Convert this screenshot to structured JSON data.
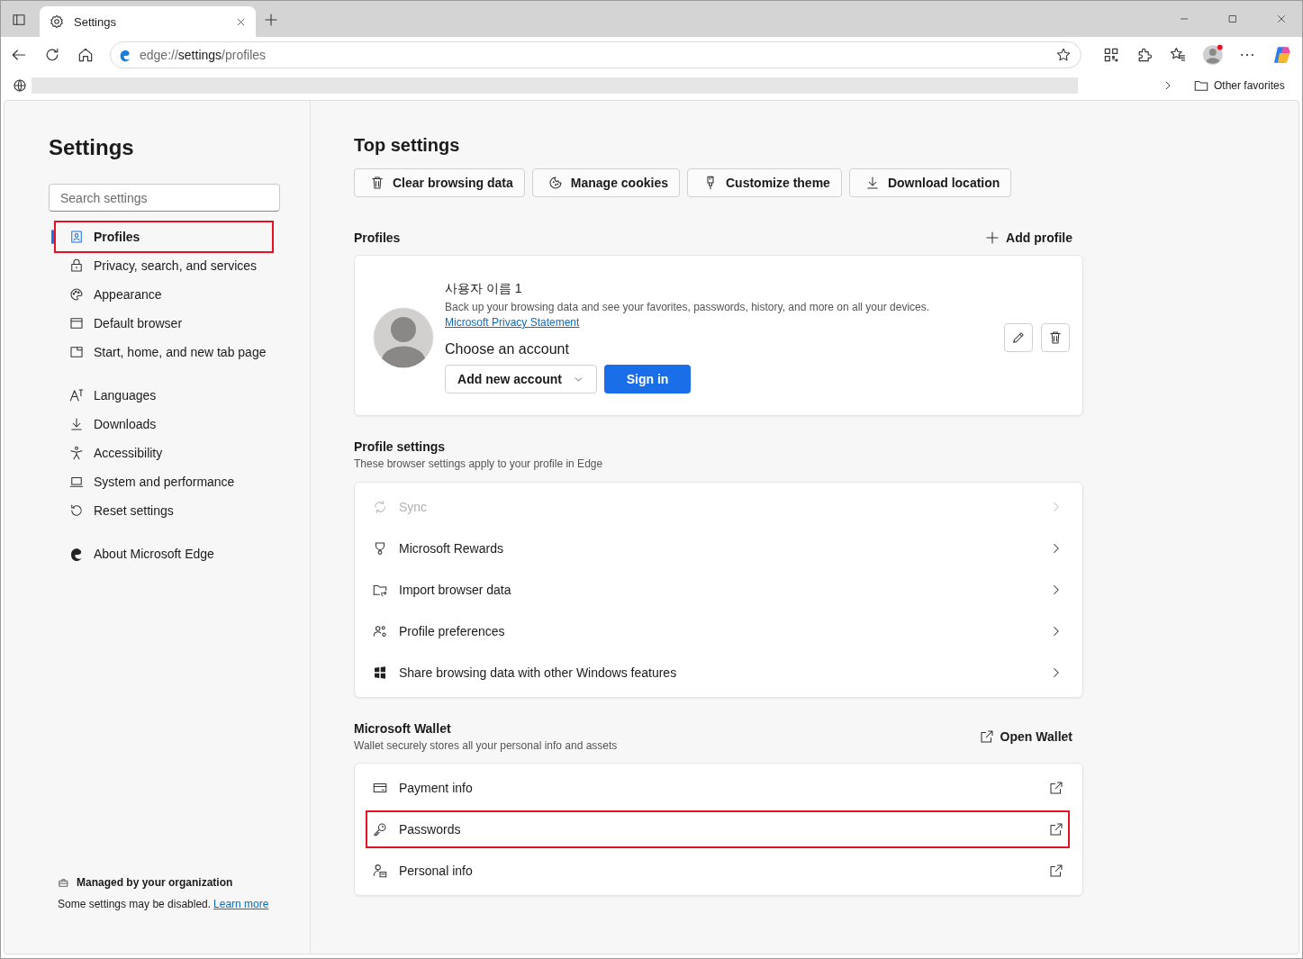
{
  "browser": {
    "tab": {
      "title": "Settings"
    },
    "address": {
      "scheme": "edge://",
      "host": "settings",
      "path": "/profiles"
    },
    "favorites": {
      "label": "Other favorites"
    }
  },
  "sidebar": {
    "title": "Settings",
    "search": {
      "placeholder": "Search settings"
    },
    "groups": [
      {
        "items": [
          {
            "label": "Profiles",
            "selected": true,
            "highlighted": true
          },
          {
            "label": "Privacy, search, and services",
            "selected": false,
            "highlighted": false
          },
          {
            "label": "Appearance",
            "selected": false,
            "highlighted": false
          },
          {
            "label": "Default browser",
            "selected": false,
            "highlighted": false
          },
          {
            "label": "Start, home, and new tab page",
            "selected": false,
            "highlighted": false
          }
        ]
      },
      {
        "items": [
          {
            "label": "Languages",
            "selected": false,
            "highlighted": false
          },
          {
            "label": "Downloads",
            "selected": false,
            "highlighted": false
          },
          {
            "label": "Accessibility",
            "selected": false,
            "highlighted": false
          },
          {
            "label": "System and performance",
            "selected": false,
            "highlighted": false
          },
          {
            "label": "Reset settings",
            "selected": false,
            "highlighted": false
          }
        ]
      },
      {
        "items": [
          {
            "label": "About Microsoft Edge",
            "selected": false,
            "highlighted": false
          }
        ]
      }
    ],
    "footer": {
      "title": "Managed by your organization",
      "note": "Some settings may be disabled.",
      "link": "Learn more"
    }
  },
  "main": {
    "title": "Top settings",
    "quick_actions": [
      "Clear browsing data",
      "Manage cookies",
      "Customize theme",
      "Download location"
    ],
    "profiles": {
      "title": "Profiles",
      "add_profile": "Add profile",
      "card": {
        "name": "사용자 이름 1",
        "description": "Back up your browsing data and see your favorites, passwords, history, and more on all your devices.",
        "privacy_link": "Microsoft Privacy Statement",
        "choose_account": "Choose an account",
        "account_dropdown": "Add new account",
        "sign_in": "Sign in"
      }
    },
    "profile_settings": {
      "title": "Profile settings",
      "subtitle": "These browser settings apply to your profile in Edge",
      "rows": [
        {
          "label": "Sync",
          "disabled": true
        },
        {
          "label": "Microsoft Rewards",
          "disabled": false
        },
        {
          "label": "Import browser data",
          "disabled": false
        },
        {
          "label": "Profile preferences",
          "disabled": false
        },
        {
          "label": "Share browsing data with other Windows features",
          "disabled": false
        }
      ]
    },
    "wallet": {
      "title": "Microsoft Wallet",
      "subtitle": "Wallet securely stores all your personal info and assets",
      "open_wallet": "Open Wallet",
      "rows": [
        {
          "label": "Payment info",
          "highlighted": false
        },
        {
          "label": "Passwords",
          "highlighted": true
        },
        {
          "label": "Personal info",
          "highlighted": false
        }
      ]
    }
  }
}
